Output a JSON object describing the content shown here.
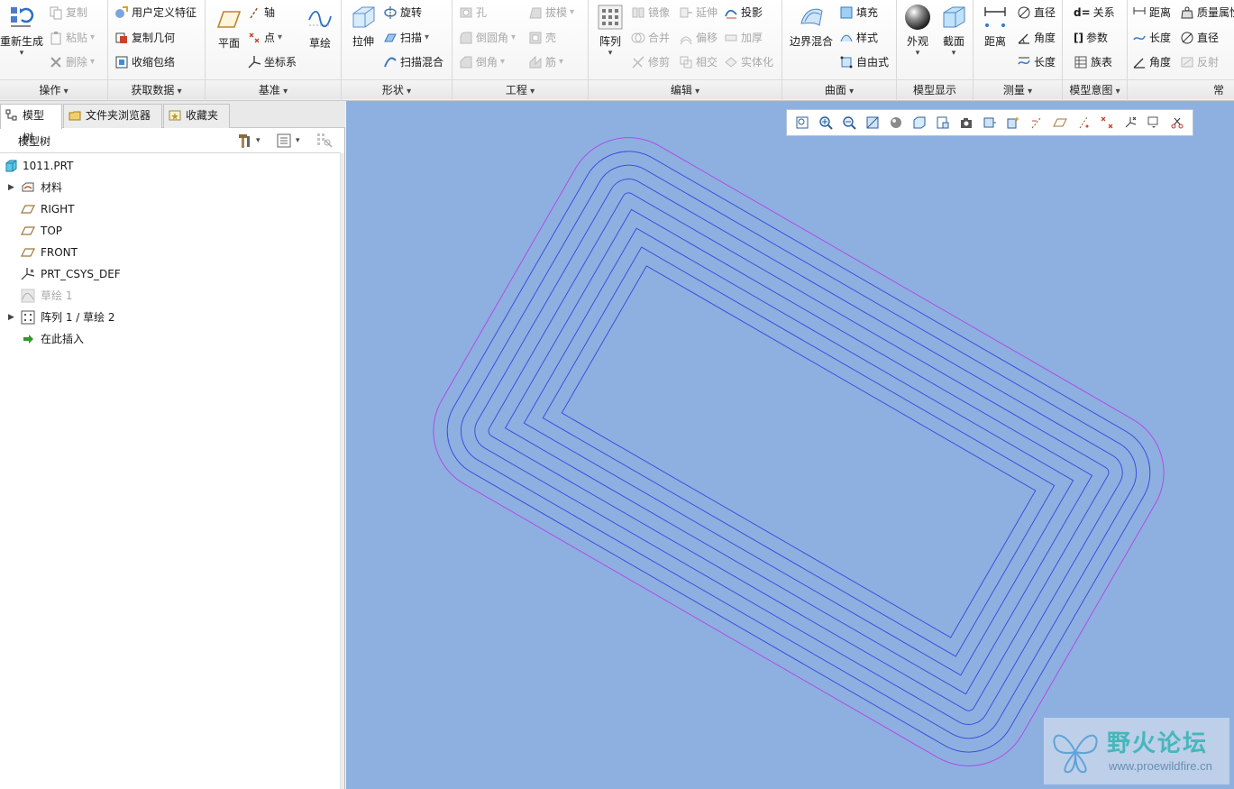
{
  "ribbon": {
    "operations": {
      "label": "操作",
      "regenerate": "重新生成",
      "copy": "复制",
      "paste": "粘贴",
      "delete": "删除"
    },
    "get_data": {
      "label": "获取数据",
      "udf": "用户定义特征",
      "copy_geom": "复制几何",
      "shrinkwrap": "收缩包络"
    },
    "datum": {
      "label": "基准",
      "plane": "平面",
      "axis": "轴",
      "point": "点",
      "csys": "坐标系",
      "sketch": "草绘"
    },
    "shapes": {
      "label": "形状",
      "extrude": "拉伸",
      "revolve": "旋转",
      "sweep": "扫描",
      "swept_blend": "扫描混合"
    },
    "engineering": {
      "label": "工程",
      "hole": "孔",
      "round": "倒圆角",
      "chamfer": "倒角",
      "draft": "拔模",
      "shell": "壳",
      "rib": "筋"
    },
    "editing": {
      "label": "编辑",
      "pattern": "阵列",
      "mirror": "镜像",
      "merge": "合并",
      "trim": "修剪",
      "extend": "延伸",
      "offset": "偏移",
      "intersect": "相交",
      "project": "投影",
      "thicken": "加厚",
      "solidify": "实体化"
    },
    "surfaces": {
      "label": "曲面",
      "boundary_blend": "边界混合",
      "fill": "填充",
      "style": "样式",
      "freestyle": "自由式"
    },
    "model_display": {
      "label": "模型显示",
      "appearance": "外观",
      "section": "截面"
    },
    "measure": {
      "label": "测量",
      "distance": "距离",
      "diameter": "直径",
      "angle": "角度",
      "length": "长度"
    },
    "model_intent": {
      "label": "模型意图",
      "relations": "关系",
      "parameters": "参数",
      "family_table": "族表"
    },
    "common": {
      "label": "常用",
      "distance": "距离",
      "length": "长度",
      "angle": "角度",
      "mass_props": "质量属性",
      "diameter": "直径",
      "reflect": "反射"
    }
  },
  "left_panel": {
    "tabs": [
      {
        "label": "模型树"
      },
      {
        "label": "文件夹浏览器"
      },
      {
        "label": "收藏夹"
      }
    ],
    "tree_title": "模型树",
    "tree": [
      {
        "label": "1011.PRT",
        "icon": "part-icon"
      },
      {
        "label": "材料",
        "icon": "material-icon",
        "expandable": true
      },
      {
        "label": "RIGHT",
        "icon": "datum-plane-icon"
      },
      {
        "label": "TOP",
        "icon": "datum-plane-icon"
      },
      {
        "label": "FRONT",
        "icon": "datum-plane-icon"
      },
      {
        "label": "PRT_CSYS_DEF",
        "icon": "csys-icon"
      },
      {
        "label": "草绘 1",
        "icon": "sketch-icon",
        "suppressed": true
      },
      {
        "label": "阵列 1 / 草绘 2",
        "icon": "pattern-icon",
        "expandable": true
      },
      {
        "label": "在此插入",
        "icon": "insert-here-arrow-icon"
      }
    ]
  },
  "viewport": {
    "background": "#8db0e0",
    "curve_color": "#3b4fe0",
    "selected_curve_color": "#b04ce8",
    "watermark": {
      "title": "野火论坛",
      "url": "www.proewildfire.cn"
    }
  }
}
